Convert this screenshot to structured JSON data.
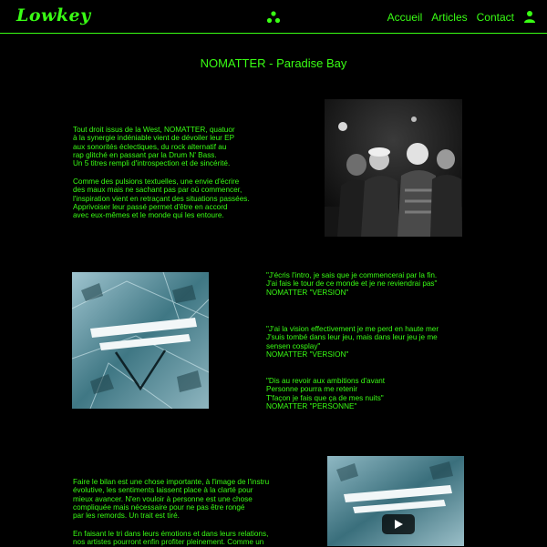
{
  "header": {
    "logo": "Lowkey",
    "nav": [
      "Accueil",
      "Articles",
      "Contact"
    ],
    "accent_color": "#39ff14",
    "center_icon": "three-dots-icon",
    "user_icon": "user-icon"
  },
  "article": {
    "title": "NOMATTER - Paradise Bay",
    "intro_paragraph_1": "Tout droit issus de la West, NOMATTER, quatuor\nà la synergie indéniable vient de dévoiler leur EP\naux sonorités éclectiques, du rock alternatif au\nrap glitché en passant par la Drum N' Bass.\nUn 5 titres rempli d'introspection et de sincérité.",
    "intro_paragraph_2": "Comme des pulsions textuelles, une envie d'écrire\ndes maux mais ne sachant pas par où commencer,\nl'inspiration vient en retraçant des situations passées.\nApprivoiser leur passé permet d'être en accord\navec eux-mêmes et le monde qui les entoure.",
    "quotes": [
      "\"J'écris l'intro, je sais que je commencerai par la fin.\nJ'ai fais le tour de ce monde et je ne reviendrai pas\"\nNOMATTER \"VERSION\"",
      "\"J'ai la vision effectivement je me perd en haute mer\nJ'suis tombé dans leur jeu, mais dans leur jeu je me\nsensen cosplay\"\nNOMATTER \"VERSION\"",
      "\"Dis au revoir aux ambitions d'avant\nPersonne pourra me retenir\nT'façon je fais que ça de mes nuits\"\nNOMATTER \"PERSONNE\""
    ],
    "outro_paragraph_1": "Faire le bilan est une chose importante, à l'image de l'instru\névolutive, les sentiments laissent place à la clarté pour\nmieux avancer. N'en vouloir à personne est une chose\ncompliquée mais nécessaire pour ne pas être rongé\npar les remords. Un trait est tiré.",
    "outro_paragraph_2": "En faisant le tri dans leurs émotions et dans leurs relations,\nnos artistes pourront enfin profiter pleinement. Comme un"
  }
}
